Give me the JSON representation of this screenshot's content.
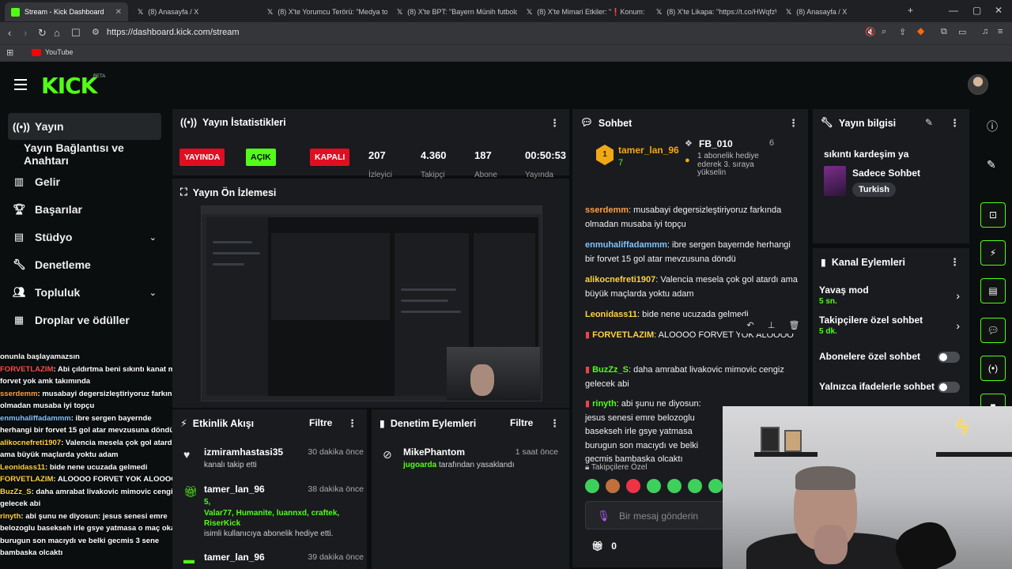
{
  "browser": {
    "tabs": [
      {
        "title": "Stream - Kick Dashboard",
        "active": true
      },
      {
        "title": "(8) Anasayfa / X"
      },
      {
        "title": "(8) X'te Yorumcu Terörü: \"Medya tos"
      },
      {
        "title": "(8) X'te BPT: \"Bayern Münih futbolcu"
      },
      {
        "title": "(8) X'te Mimari Etkiler: \"❗Konum: B"
      },
      {
        "title": "(8) X'te Likapa: \"https://t.co/HWqfzW"
      },
      {
        "title": "(8) Anasayfa / X"
      }
    ],
    "url": "https://dashboard.kick.com/stream",
    "bookmark": "YouTube"
  },
  "header": {
    "logo": "KICK",
    "beta": "BETA"
  },
  "sidebar": {
    "items": [
      {
        "label": "Yayın",
        "icon": "broadcast-icon"
      },
      {
        "label": "Yayın Bağlantısı ve Anahtarı"
      },
      {
        "label": "Gelir",
        "icon": "chart-icon"
      },
      {
        "label": "Başarılar",
        "icon": "trophy-icon"
      },
      {
        "label": "Stüdyo",
        "icon": "layout-icon"
      },
      {
        "label": "Denetleme",
        "icon": "wrench-icon"
      },
      {
        "label": "Topluluk",
        "icon": "people-icon"
      },
      {
        "label": "Droplar ve ödüller",
        "icon": "drops-icon"
      }
    ]
  },
  "overlay_chat": [
    {
      "user": "",
      "text": "onunla başlayamazsın"
    },
    {
      "user": "FORVETLAZIM",
      "text": ": Abi çıldırtma beni sıkıntı kanat mı forvet yok amk takımında"
    },
    {
      "user": "sserdemm",
      "text": ": musabayi degersizleştiriyoruz farkında olmadan musaba iyi topçu"
    },
    {
      "user": "enmuhaliffadammm",
      "text": ": ibre sergen bayernde herhangi bir forvet 15 gol atar mevzusuna döndü"
    },
    {
      "user": "alikocnefreti1907",
      "text": ": Valencia mesela çok gol atardı ama büyük maçlarda yoktu adam"
    },
    {
      "user": "Leonidass11",
      "text": ": bide nene ucuzada gelmedi"
    },
    {
      "user": "FORVETLAZIM",
      "text": ": ALOOOO FORVET YOK ALOOOO"
    },
    {
      "user": "BuzZz_S",
      "text": ": daha amrabat livakovic mimovic cengiz gelecek abi"
    },
    {
      "user": "rinyth",
      "text": ": abi şunu ne diyosun: jesus senesi emre belozoglu basekseh irle gsye yatmasa o maç okan burugun son macıydı ve belki gecmis 3 sene bambaska olcaktı"
    }
  ],
  "stats": {
    "title": "Yayın İstatistikleri",
    "live": "YAYINDA",
    "open": "AÇIK",
    "closed": "KAPALI",
    "viewers": "207",
    "viewers_label": "İzleyici",
    "followers": "4.360",
    "followers_label": "Takipçi",
    "subs": "187",
    "subs_label": "Abone",
    "duration": "00:50:53",
    "duration_label": "Yayında"
  },
  "preview": {
    "title": "Yayın Ön İzlemesi"
  },
  "activity": {
    "title": "Etkinlik Akışı",
    "filter": "Filtre",
    "rows": [
      {
        "name": "izmiramhastasi35",
        "time": "30 dakika önce",
        "sub": "kanalı takip etti"
      },
      {
        "name": "tamer_lan_96",
        "time": "38 dakika önce",
        "count": "5,",
        "names": "Valar77, Humanite, luannxd, craftek, RiserKick",
        "sub": "isimli kullanıcıya abonelik hediye etti."
      },
      {
        "name": "tamer_lan_96",
        "time": "39 dakika önce"
      }
    ]
  },
  "moderation": {
    "title": "Denetim Eylemleri",
    "filter": "Filtre",
    "rows": [
      {
        "name": "MikePhantom",
        "time": "1 saat önce",
        "target": "jugoarda",
        "sub": "tarafından yasaklandı"
      }
    ]
  },
  "chat": {
    "title": "Sohbet",
    "pinned": {
      "rank": "1",
      "user": "tamer_lan_96",
      "count": "7",
      "user2": "FB_010",
      "count2": "6",
      "note": "1 abonelik hediye ederek 3. sıraya yükselin"
    },
    "messages": [
      {
        "user": "sserdemm",
        "text": " musabayi degersizleştiriyoruz farkında olmadan musaba iyi topçu",
        "color": "#ff9f40"
      },
      {
        "user": "enmuhaliffadammm",
        "text": " ibre sergen bayernde herhangi bir forvet 15 gol atar mevzusuna döndü",
        "color": "#7fc3ff"
      },
      {
        "user": "alikocnefreti1907",
        "text": " Valencia mesela çok gol atardı ama büyük maçlarda yoktu adam",
        "color": "#ffd23f"
      },
      {
        "user": "Leonidass11",
        "text": " bide nene ucuzada gelmedi",
        "color": "#ffd23f"
      },
      {
        "user": "FORVETLAZIM",
        "text": " ALOOOO FORVET YOK ALOOOO",
        "color": "#ffd23f"
      },
      {
        "user": "BuzZz_S",
        "text": " daha amrabat livakovic mimovic cengiz gelecek abi",
        "color": "#53fc18"
      },
      {
        "user": "rinyth",
        "text": " abi şunu ne diyosun: jesus senesi emre belozoglu basekseh irle gsye yatmasa burugun son macıydı ve belki gecmis bambaska olcaktı",
        "color": "#53fc18"
      }
    ],
    "followers_only": "Takipçilere Özel",
    "placeholder": "Bir mesaj gönderin",
    "points": "0"
  },
  "info": {
    "title": "Yayın bilgisi",
    "stream_title": "sıkıntı kardeşim ya",
    "category": "Sadece Sohbet",
    "tag": "Turkish"
  },
  "channel_actions": {
    "title": "Kanal Eylemleri",
    "slow": {
      "label": "Yavaş mod",
      "value": "5 sn."
    },
    "followers": {
      "label": "Takipçilere özel sohbet",
      "value": "5 dk."
    },
    "subs_only": "Abonelere özel sohbet",
    "emote_only": "Yalnızca ifadelerle sohbet"
  },
  "colors": {
    "accent": "#53fc18",
    "live": "#e10e22",
    "panel": "#191b1f",
    "bg": "#0b0e0f"
  }
}
